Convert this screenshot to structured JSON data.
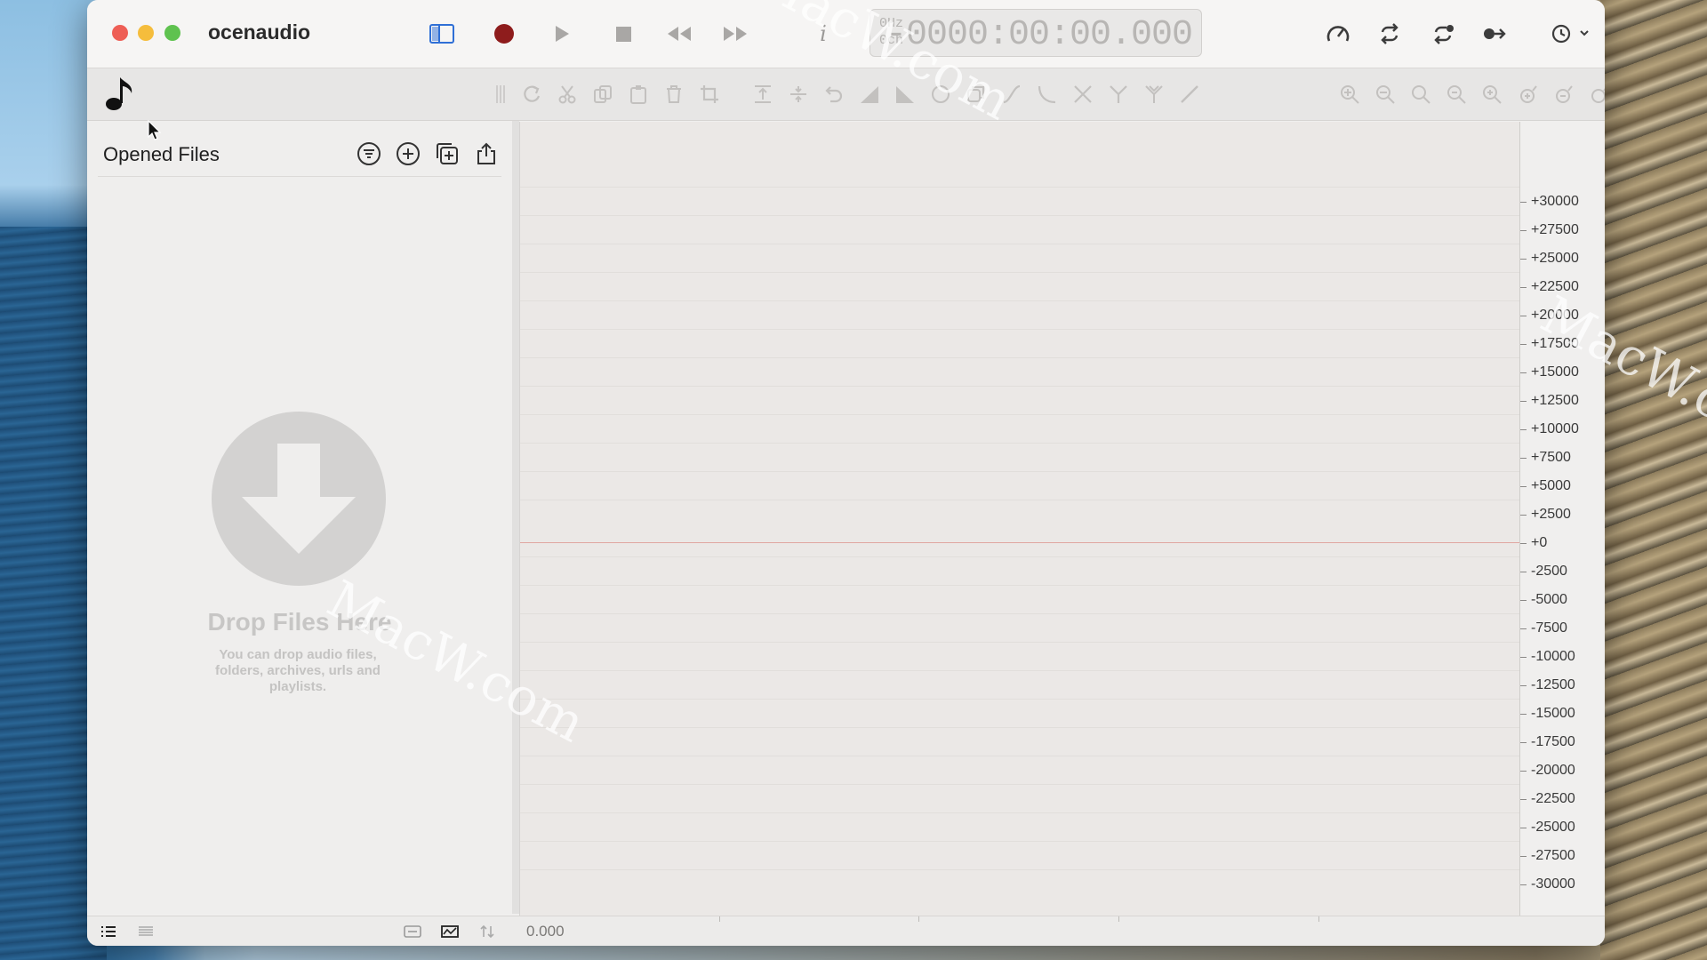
{
  "app": {
    "title": "ocenaudio"
  },
  "timer": {
    "sample_rate": "0Hz",
    "channels": "0ch",
    "time": "-0000:00:00.000"
  },
  "sidebar": {
    "title": "Opened Files"
  },
  "drop_zone": {
    "title": "Drop Files Here",
    "subtitle": "You can drop audio files, folders, archives, urls and playlists."
  },
  "waveform": {
    "y_axis_labels": [
      "+30000",
      "+27500",
      "+25000",
      "+22500",
      "+20000",
      "+17500",
      "+15000",
      "+12500",
      "+10000",
      "+7500",
      "+5000",
      "+2500",
      "+0",
      "-2500",
      "-5000",
      "-7500",
      "-10000",
      "-12500",
      "-15000",
      "-17500",
      "-20000",
      "-22500",
      "-25000",
      "-27500",
      "-30000"
    ],
    "timeline_start": "0.000"
  },
  "watermark": "MacW.com",
  "colors": {
    "record": "#8e1c1c",
    "accent": "#2f6fd6",
    "zero_line": "#e0a7a2"
  }
}
